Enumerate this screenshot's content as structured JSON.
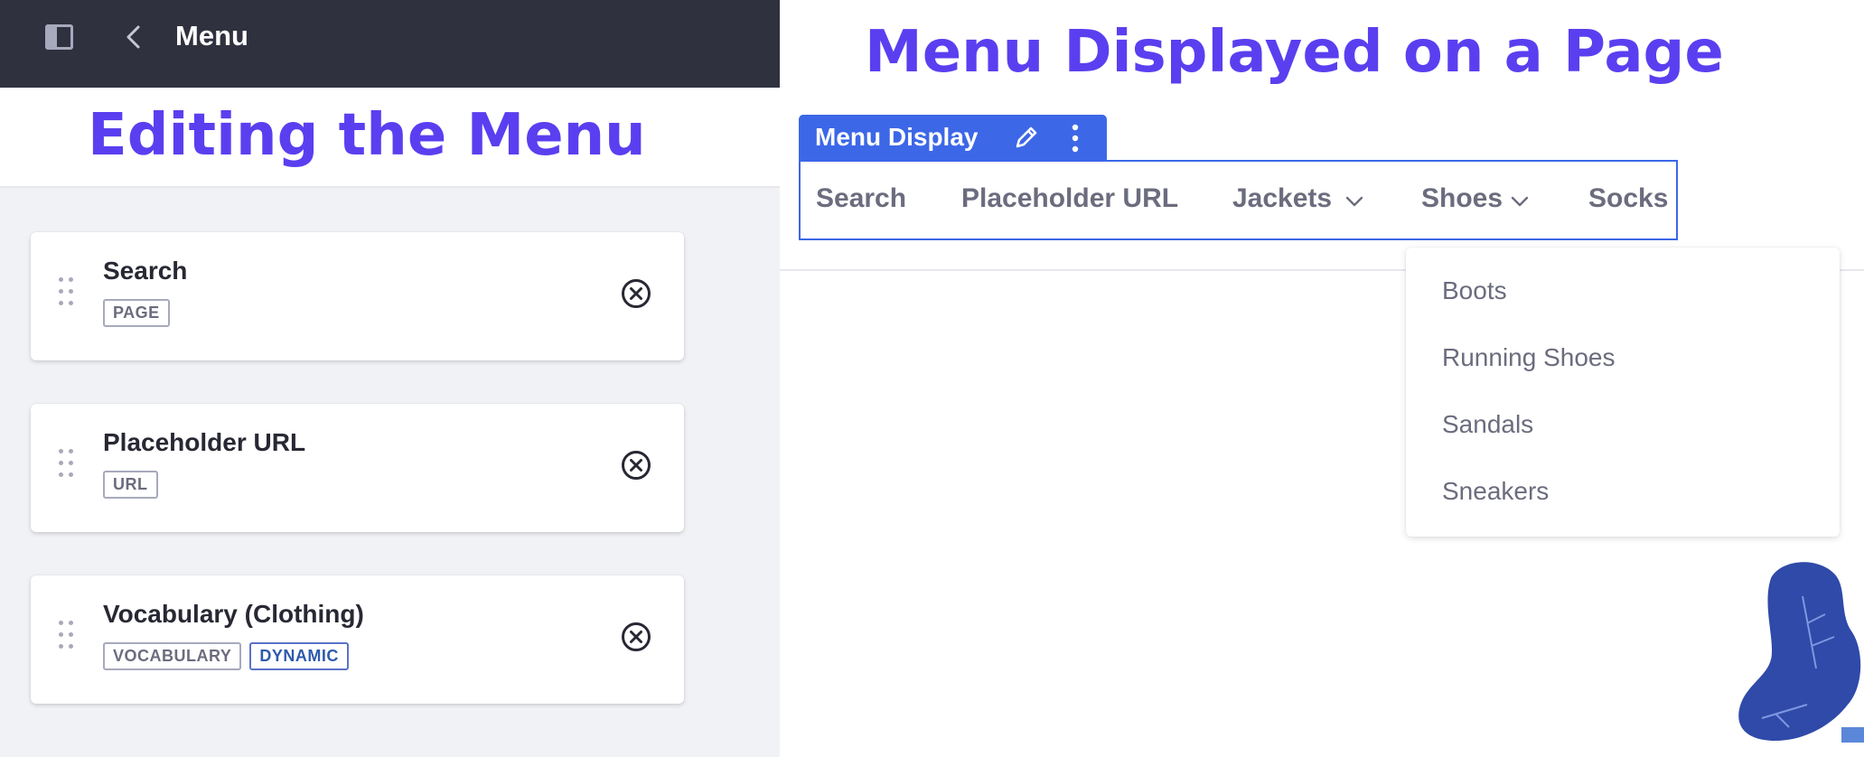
{
  "left_panel": {
    "topbar": {
      "title": "Menu",
      "sidebar_toggle_icon": "sidebar-panel-icon",
      "back_icon": "chevron-left-icon"
    },
    "heading": "Editing the Menu",
    "items": [
      {
        "title": "Search",
        "tags": [
          {
            "label": "PAGE",
            "style": "default"
          }
        ]
      },
      {
        "title": "Placeholder URL",
        "tags": [
          {
            "label": "URL",
            "style": "default"
          }
        ]
      },
      {
        "title": "Vocabulary (Clothing)",
        "tags": [
          {
            "label": "VOCABULARY",
            "style": "default"
          },
          {
            "label": "DYNAMIC",
            "style": "primary"
          }
        ]
      }
    ],
    "drag_icon": "drag-handle-icon",
    "remove_icon": "times-circle-icon"
  },
  "right_panel": {
    "heading": "Menu Displayed on a Page",
    "fragment": {
      "label": "Menu Display",
      "edit_icon": "pencil-icon",
      "options_icon": "ellipsis-v-icon"
    },
    "nav": {
      "items": [
        {
          "label": "Search",
          "has_dropdown": false
        },
        {
          "label": "Placeholder URL",
          "has_dropdown": false
        },
        {
          "label": "Jackets",
          "has_dropdown": true
        },
        {
          "label": "Shoes",
          "has_dropdown": true
        },
        {
          "label": "Socks",
          "has_dropdown": false
        }
      ]
    },
    "dropdown": {
      "parent": "Shoes",
      "items": [
        "Boots",
        "Running Shoes",
        "Sandals",
        "Sneakers"
      ]
    }
  },
  "colors": {
    "heading_accent": "#5a3ff0",
    "fragment_blue": "#3c67e7",
    "topbar_dark": "#30313f",
    "panel_bg": "#f1f2f5",
    "text_dark": "#272833",
    "text_muted": "#6b6c7e",
    "plant_blue": "#2f4aa8"
  }
}
